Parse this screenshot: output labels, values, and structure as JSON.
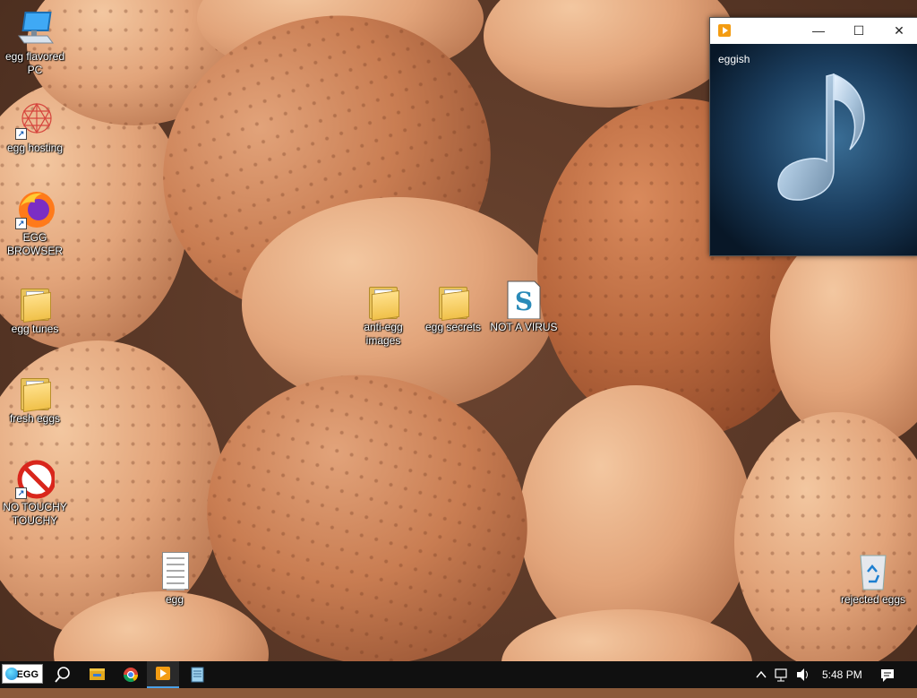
{
  "desktop": {
    "icons": [
      {
        "label": "egg flavored\nPC",
        "kind": "computer"
      },
      {
        "label": "egg hosting",
        "kind": "network"
      },
      {
        "label": "EGG\nBROWSER",
        "kind": "browser"
      },
      {
        "label": "egg tunes",
        "kind": "folder"
      },
      {
        "label": "fresh eggs",
        "kind": "folder"
      },
      {
        "label": "NO TOUCHY\nTOUCHY",
        "kind": "prohibited"
      },
      {
        "label": "anti-egg\nimages",
        "kind": "folder"
      },
      {
        "label": "egg secrets",
        "kind": "folder"
      },
      {
        "label": "NOT A VIRUS",
        "kind": "script"
      },
      {
        "label": "egg",
        "kind": "document"
      },
      {
        "label": "rejected eggs",
        "kind": "recycle-bin"
      }
    ]
  },
  "media_window": {
    "title": "",
    "track_title": "eggish",
    "controls": {
      "minimize": "—",
      "maximize": "☐",
      "close": "✕"
    }
  },
  "taskbar": {
    "start_label": "EGG",
    "apps": [
      "search",
      "file-explorer",
      "chrome",
      "media-player",
      "notepad"
    ],
    "active_app": "media-player",
    "clock": "5:48 PM"
  },
  "colors": {
    "taskbar_bg": "#101010",
    "accent": "#4aa0e6"
  }
}
